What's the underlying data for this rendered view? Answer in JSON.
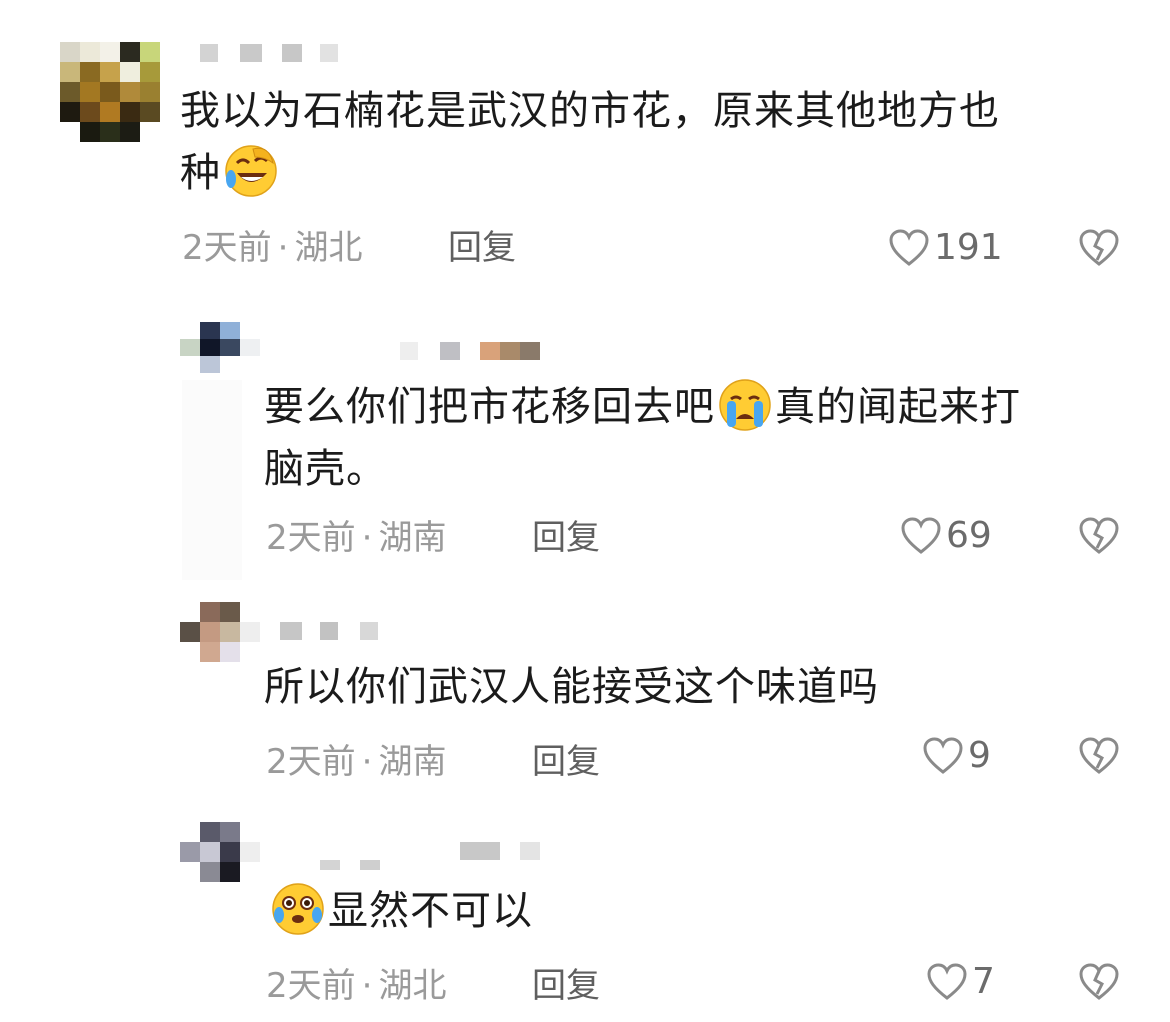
{
  "comments": [
    {
      "text_line1": "我以为石楠花是武汉的市花，原来其他地方也",
      "text_line2": "种",
      "emoji": "laughing-crying-emoji",
      "time": "2天前",
      "location": "湖北",
      "reply_label": "回复",
      "likes": "191"
    },
    {
      "text_line1a": "要么你们把市花移回去吧",
      "emoji": "crying-emoji",
      "text_line1b": "真的闻起来打",
      "text_line2": "脑壳。",
      "time": "2天前",
      "location": "湖南",
      "reply_label": "回复",
      "likes": "69"
    },
    {
      "text_line1": "所以你们武汉人能接受这个味道吗",
      "time": "2天前",
      "location": "湖南",
      "reply_label": "回复",
      "likes": "9"
    },
    {
      "emoji": "tearful-emoji",
      "text_line1": "显然不可以",
      "time": "2天前",
      "location": "湖北",
      "reply_label": "回复",
      "likes": "7"
    }
  ],
  "meta_separator": "·",
  "colors": {
    "text": "#1b1b1b",
    "meta": "#9a9a9a",
    "reply": "#5f5f5f",
    "icon": "#8a8a8a",
    "emoji_yellow": "#ffcc33"
  }
}
